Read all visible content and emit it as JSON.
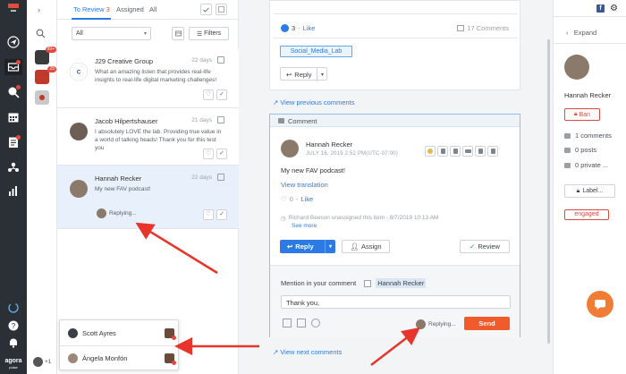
{
  "brand": {
    "name": "agora",
    "sub": "pulse"
  },
  "colors": {
    "accent": "#2c7be5",
    "danger": "#e2483d",
    "send": "#f15a2b",
    "arrow": "#e8352b"
  },
  "accounts": {
    "badges": [
      "99+",
      "25"
    ]
  },
  "list": {
    "tabs": [
      {
        "label": "To Review",
        "count": "3"
      },
      {
        "label": "Assigned"
      },
      {
        "label": "All"
      }
    ],
    "filter_select": "All",
    "filters_label": "Filters",
    "items": [
      {
        "name": "J29 Creative Group",
        "time": "22 days",
        "text": "What an amazing listen that provides real-life insights to real-life digital marketing challenges!"
      },
      {
        "name": "Jacob Hilpertshauser",
        "time": "21 days",
        "text": "I absolutely LOVE the lab. Providing true value in a world of talking heads! Thank you for this test you"
      },
      {
        "name": "Hannah Recker",
        "time": "22 days",
        "text": "My new FAV podcast!",
        "status": "Replying..."
      }
    ]
  },
  "popover": {
    "users": [
      "Scott Ayres",
      "Ángela Monfón"
    ],
    "more": "+1"
  },
  "thread": {
    "like_count": "3",
    "like_label": "Like",
    "comments_count": "17 Comments",
    "tag": "Social_Media_Lab",
    "reply_label": "Reply",
    "view_previous": "View previous comments",
    "view_next": "View next comments",
    "comment": {
      "header": "Comment",
      "author": "Hannah Recker",
      "date": "JULY 16, 2019 2:52 PM(UTC-07:00)",
      "text": "My new FAV podcast!",
      "translate": "View translation",
      "likes": "0",
      "like_label": "Like",
      "log": "Richard Beeson unassigned this item - 8/7/2019 10:13 AM",
      "see_more": "See more",
      "reply_label": "Reply",
      "assign_label": "Assign",
      "review_label": "Review"
    },
    "reply_box": {
      "mention_label": "Mention in your comment",
      "mention_name": "Hannah Recker",
      "input_value": "Thank you,",
      "replying": "Replying...",
      "send_label": "Send"
    }
  },
  "profile": {
    "expand": "Expand",
    "name": "Hannah Recker",
    "ban": "Ban",
    "stats": [
      "1 comments",
      "0 posts",
      "0 private ..."
    ],
    "label_btn": "Label...",
    "label_tag": "engaged"
  }
}
